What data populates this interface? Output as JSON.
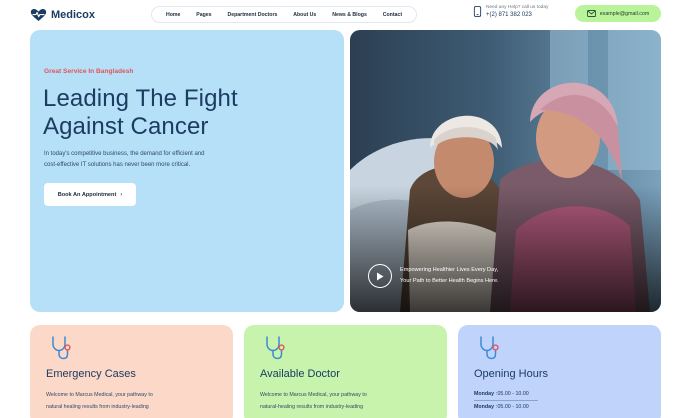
{
  "brand": {
    "name": "Medicox",
    "color": "#1c3c62"
  },
  "nav": {
    "items": [
      "Home",
      "Pages",
      "Department Doctors",
      "About Us",
      "News & Blogs",
      "Contact"
    ]
  },
  "help": {
    "label": "Need any Help? call us today",
    "phone": "+(2) 871 382 023"
  },
  "email_button": {
    "label": "example@gmail.com",
    "color": "#b9f39a"
  },
  "hero": {
    "eyebrow": "Great Service In Bangladesh",
    "title_line1": "Leading The Fight",
    "title_line2": "Against Cancer",
    "desc_line1": "In today's competitive business, the demand for efficient and",
    "desc_line2": "cost-effective IT solutions has never been more critical.",
    "cta_label": "Book An Appointment",
    "cta_arrow": "›",
    "background": "#b6e0f7"
  },
  "video": {
    "caption_line1": "Empowering Healthier Lives Every Day,",
    "caption_line2": "Your Path to Better Health Begins Here.",
    "play_icon": "play-icon"
  },
  "cards": [
    {
      "title": "Emergency Cases",
      "text_line1": "Welcome to Marcus Medical, your pathway to",
      "text_line2": "natural healing results from industry-leading",
      "icon": "stethoscope-icon",
      "color": "#fbd8c8"
    },
    {
      "title": "Available Doctor",
      "text_line1": "Welcome to Marcus Medical, your pathway to",
      "text_line2": "natural-healing results from industry-leading",
      "icon": "stethoscope-icon",
      "color": "#c7f3ad"
    },
    {
      "title": "Opening Hours",
      "hours": [
        {
          "day": "Monday",
          "time": ":05.00 - 10.00"
        },
        {
          "day": "Monday",
          "time": ":05.00 - 10.00"
        }
      ],
      "icon": "stethoscope-icon",
      "color": "#bfd3fb"
    }
  ]
}
